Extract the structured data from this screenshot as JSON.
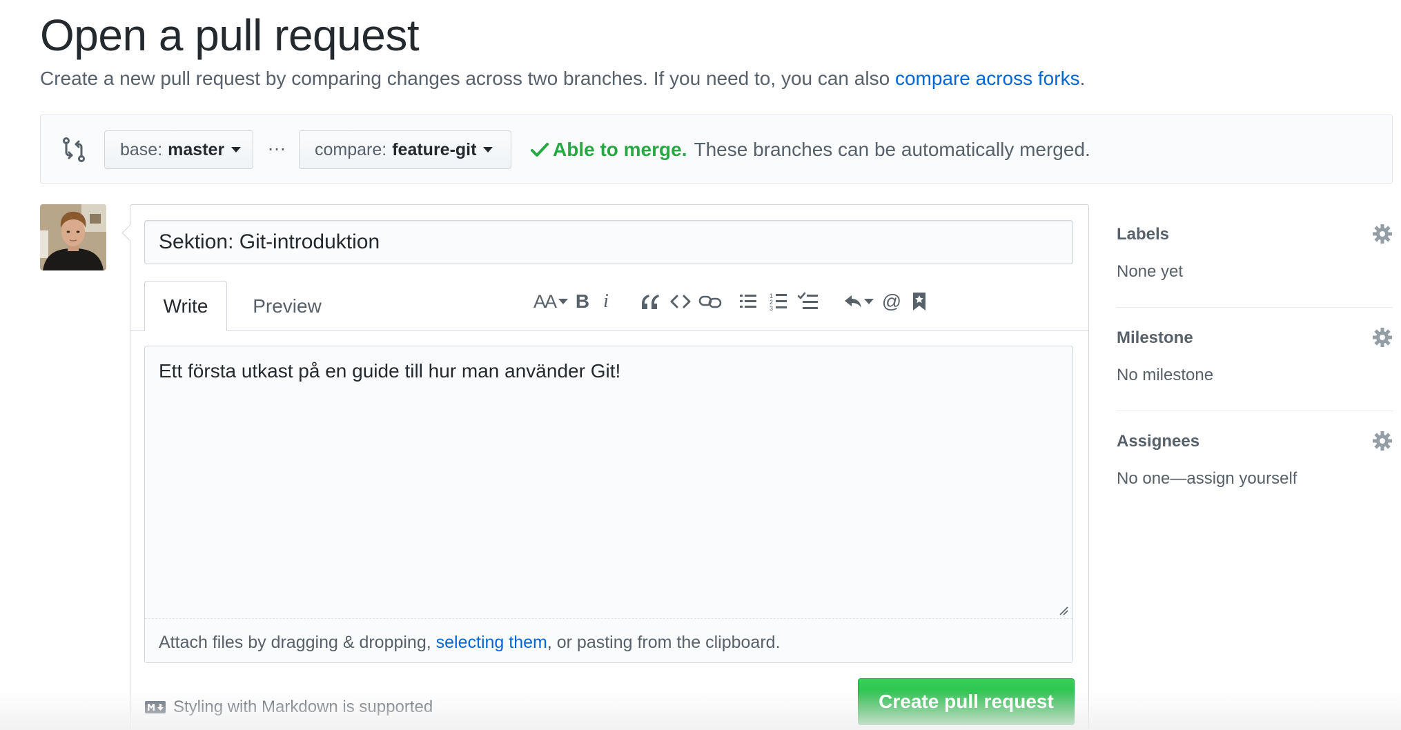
{
  "header": {
    "title": "Open a pull request",
    "subtitle": "Create a new pull request by comparing changes across two branches. If you need to, you can also ",
    "subtitle_link": "compare across forks",
    "subtitle_end": "."
  },
  "range": {
    "base_prefix": "base:",
    "base_branch": "master",
    "dots": "…",
    "compare_prefix": "compare:",
    "compare_branch": "feature-git",
    "merge_ok": "Able to merge.",
    "merge_message": "These branches can be automatically merged."
  },
  "form": {
    "title_value": "Sektion: Git-introduktion",
    "tabs": [
      {
        "label": "Write",
        "active": true
      },
      {
        "label": "Preview",
        "active": false
      }
    ],
    "toolbar": {
      "header_label": "AA",
      "bold_label": "B",
      "italic_label": "i",
      "quote_icon": "quote-icon",
      "code_icon": "code-icon",
      "link_icon": "link-icon",
      "unordered_list_icon": "list-unordered-icon",
      "ordered_list_icon": "list-ordered-icon",
      "tasklist_icon": "tasklist-icon",
      "reply_icon": "reply-icon",
      "mention_label": "@",
      "reference_icon": "bookmark-icon"
    },
    "body_value": "Ett första utkast på en guide till hur man använder Git!",
    "attach_text_1": "Attach files by dragging & dropping, ",
    "attach_link": "selecting them",
    "attach_text_2": ", or pasting from the clipboard.",
    "markdown_hint": "Styling with Markdown is supported",
    "submit_label": "Create pull request"
  },
  "sidebar": {
    "sections": [
      {
        "heading": "Labels",
        "value": "None yet"
      },
      {
        "heading": "Milestone",
        "value": "No milestone"
      },
      {
        "heading": "Assignees",
        "value": "No one—assign yourself"
      }
    ]
  },
  "colors": {
    "accent_link": "#0366d6",
    "success_green": "#28a745",
    "text_primary": "#24292e",
    "text_muted": "#586069"
  }
}
